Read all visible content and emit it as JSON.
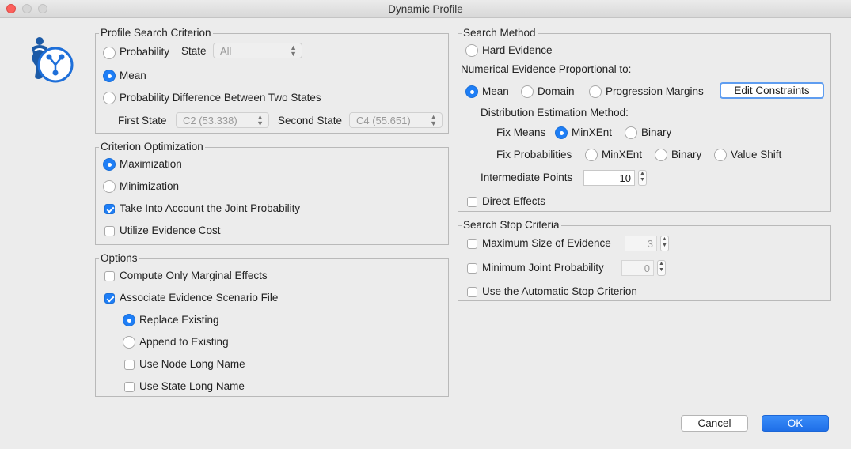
{
  "window": {
    "title": "Dynamic Profile"
  },
  "profile_search": {
    "title": "Profile Search Criterion",
    "probability": "Probability",
    "state_label": "State",
    "state_value": "All",
    "mean": "Mean",
    "prob_diff": "Probability Difference Between Two States",
    "first_state_label": "First State",
    "first_state_value": "C2 (53.338)",
    "second_state_label": "Second State",
    "second_state_value": "C4 (55.651)"
  },
  "criterion_opt": {
    "title": "Criterion Optimization",
    "maximization": "Maximization",
    "minimization": "Minimization",
    "joint_prob": "Take Into Account the Joint Probability",
    "evidence_cost": "Utilize Evidence Cost"
  },
  "options": {
    "title": "Options",
    "marginal": "Compute Only Marginal Effects",
    "associate": "Associate Evidence Scenario File",
    "replace": "Replace Existing",
    "append": "Append to Existing",
    "node_long": "Use Node Long Name",
    "state_long": "Use State Long Name"
  },
  "search_method": {
    "title": "Search Method",
    "hard_evidence": "Hard Evidence",
    "numerical": "Numerical Evidence Proportional to:",
    "mean": "Mean",
    "domain": "Domain",
    "progression": "Progression Margins",
    "edit_constraints": "Edit Constraints",
    "dist_method": "Distribution Estimation Method:",
    "fix_means": "Fix Means",
    "minxent": "MinXEnt",
    "binary": "Binary",
    "fix_probs": "Fix Probabilities",
    "value_shift": "Value Shift",
    "intermediate": "Intermediate Points",
    "intermediate_value": "10",
    "direct_effects": "Direct Effects"
  },
  "stop_criteria": {
    "title": "Search Stop Criteria",
    "max_size": "Maximum Size of Evidence",
    "max_size_value": "3",
    "min_joint": "Minimum Joint Probability",
    "min_joint_value": "0",
    "automatic": "Use the Automatic Stop Criterion"
  },
  "buttons": {
    "cancel": "Cancel",
    "ok": "OK"
  },
  "colors": {
    "accent": "#1e7ef6",
    "background": "#ececec"
  }
}
